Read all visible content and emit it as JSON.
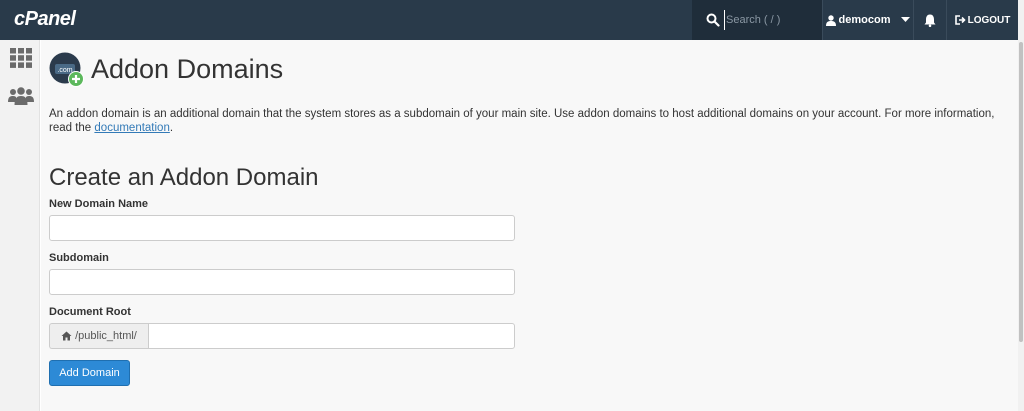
{
  "header": {
    "logo_text": "cPanel",
    "search_placeholder": "Search ( / )",
    "username": "democom",
    "logout_label": "LOGOUT"
  },
  "page": {
    "title": "Addon Domains",
    "description_text": "An addon domain is an additional domain that the system stores as a subdomain of your main site. Use addon domains to host additional domains on your account. For more information, read the ",
    "description_link": "documentation",
    "description_end": "."
  },
  "form": {
    "section_title": "Create an Addon Domain",
    "new_domain_label": "New Domain Name",
    "new_domain_value": "",
    "subdomain_label": "Subdomain",
    "subdomain_value": "",
    "docroot_label": "Document Root",
    "docroot_prefix": "/public_html/",
    "docroot_value": "",
    "submit_label": "Add Domain"
  },
  "icons": {
    "search": "search-icon",
    "user": "user-icon",
    "caret": "caret-down-icon",
    "bell": "bell-icon",
    "logout": "logout-icon",
    "apps_grid": "grid-icon",
    "users": "users-icon",
    "home": "home-icon",
    "page": "addon-domain-icon"
  },
  "colors": {
    "topbar": "#293a4a",
    "primary_button": "#2d8ad6",
    "link": "#337ab7"
  }
}
